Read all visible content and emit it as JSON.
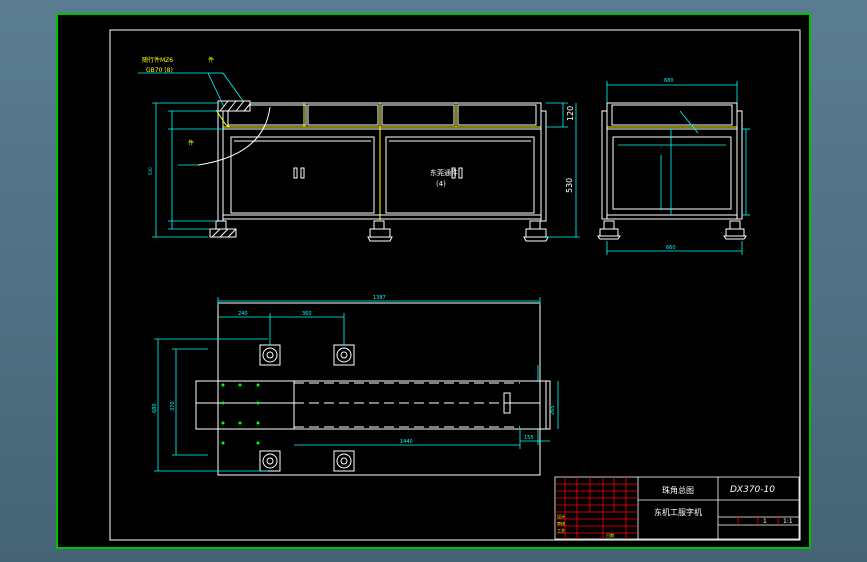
{
  "title_block": {
    "part_name": "珠角总图",
    "drawing_no": "DX370-10",
    "product_name": "东机工服字机",
    "scale": "1:1",
    "sheet_no": "1",
    "field_labels": [
      "设计",
      "审核",
      "工艺",
      "日期"
    ]
  },
  "front_view": {
    "callout_top_1": "随行件MZ6",
    "callout_top_2": "GB70 (8)",
    "callout_top_3": "件",
    "callout_mid": "件",
    "door_label_1": "东莞通件",
    "door_label_2": "(4)",
    "dim_right_top": "120",
    "dim_right_total": "530"
  },
  "side_view": {
    "dim_top": "680",
    "dim_bottom": "660"
  },
  "plan_view": {
    "dim_top_total": "1387",
    "dim_top_a": "240",
    "dim_top_b": "360",
    "dim_left_total": "680",
    "dim_left_inner": "370",
    "dim_bottom": "1440",
    "dim_right": "265",
    "dim_bottom_right": "155"
  },
  "colors": {
    "frame": "#00c000",
    "lines": "#ffffff",
    "dims": "#00ffff",
    "highlight": "#ffff00",
    "titleblock": "#ff0000",
    "text": "#ffffff"
  }
}
